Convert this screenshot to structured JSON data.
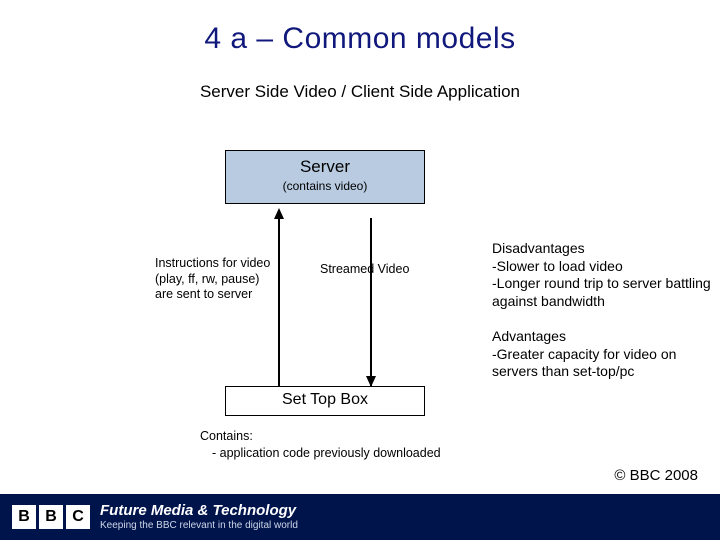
{
  "title": "4 a – Common models",
  "subtitle": "Server Side Video / Client Side Application",
  "server": {
    "name": "Server",
    "sub": "(contains video)"
  },
  "stb": {
    "name": "Set Top Box"
  },
  "left_label": "Instructions for video\n(play, ff, rw, pause)\nare sent to server",
  "mid_label": "Streamed Video",
  "right": {
    "dis_head": "Disadvantages",
    "dis_1": "-Slower to load video",
    "dis_2": "-Longer round trip to server battling against bandwidth",
    "adv_head": "Advantages",
    "adv_1": "-Greater capacity for video on servers than set-top/pc"
  },
  "contains": {
    "head": "Contains:",
    "line1": "- application code previously downloaded"
  },
  "footer": {
    "brand_1": "B",
    "brand_2": "B",
    "brand_3": "C",
    "line1": "Future Media & Technology",
    "line2": "Keeping the BBC relevant in the digital world"
  },
  "copyright": "© BBC 2008"
}
